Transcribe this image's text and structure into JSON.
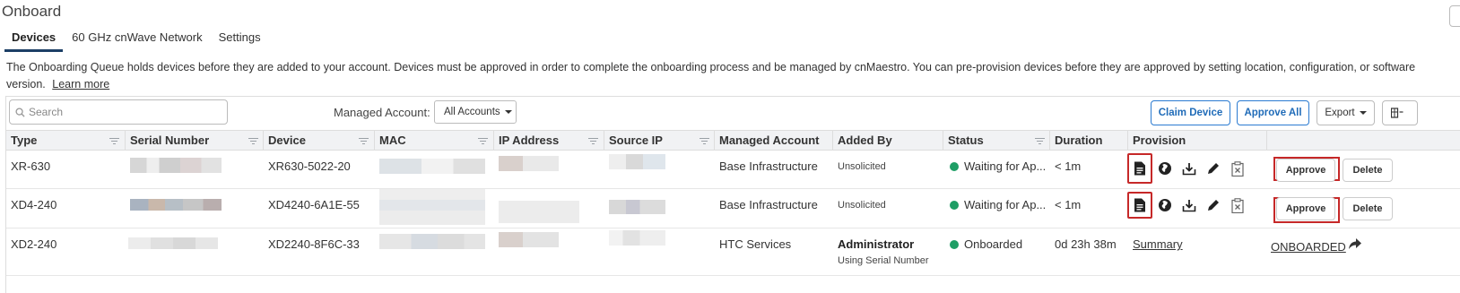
{
  "page": {
    "title": "Onboard"
  },
  "tabs": [
    {
      "label": "Devices",
      "active": true
    },
    {
      "label": "60 GHz cnWave Network",
      "active": false
    },
    {
      "label": "Settings",
      "active": false
    }
  ],
  "description": {
    "text": "The Onboarding Queue holds devices before they are added to your account. Devices must be approved in order to complete the onboarding process and be managed by cnMaestro. You can pre-provision devices before they are approved by setting location, configuration, or software version.",
    "learn_more": "Learn more"
  },
  "toolbar": {
    "search_placeholder": "Search",
    "managed_account_label": "Managed Account:",
    "managed_account_value": "All Accounts",
    "claim_device": "Claim Device",
    "approve_all": "Approve All",
    "export": "Export"
  },
  "columns": [
    "Type",
    "Serial Number",
    "Device",
    "MAC",
    "IP Address",
    "Source IP",
    "Managed Account",
    "Added By",
    "Status",
    "Duration",
    "Provision"
  ],
  "rows": [
    {
      "type": "XR-630",
      "device": "XR630-5022-20",
      "managed_account": "Base Infrastructure",
      "added_by": "Unsolicited",
      "status": "Waiting for Ap...",
      "duration": "< 1m",
      "approve": "Approve",
      "delete": "Delete"
    },
    {
      "type": "XD4-240",
      "device": "XD4240-6A1E-55",
      "managed_account": "Base Infrastructure",
      "added_by": "Unsolicited",
      "status": "Waiting for Ap...",
      "duration": "< 1m",
      "approve": "Approve",
      "delete": "Delete"
    },
    {
      "type": "XD2-240",
      "device": "XD2240-8F6C-33",
      "managed_account": "HTC Services",
      "added_by": "Administrator",
      "added_by_sub": "Using Serial Number",
      "status": "Onboarded",
      "duration": "0d 23h 38m",
      "summary": "Summary",
      "onboarded": "ONBOARDED"
    }
  ],
  "colors": {
    "accent": "#1f6bb8",
    "status_green": "#1e9e65",
    "highlight_red": "#c62828",
    "tab_underline": "#1c3f66"
  },
  "icons": [
    "search-icon",
    "document-icon",
    "globe-icon",
    "download-icon",
    "pencil-icon",
    "clipboard-x-icon",
    "share-arrow-icon",
    "columns-icon"
  ]
}
